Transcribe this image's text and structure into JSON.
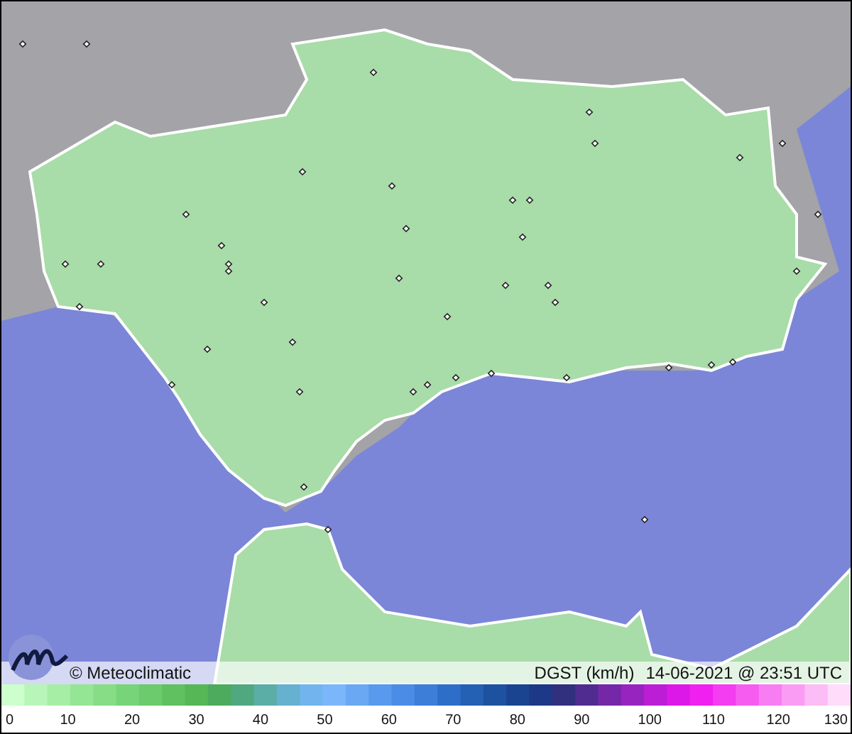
{
  "map": {
    "credit": "© Meteoclimatic",
    "variable": "DGST (km/h)",
    "timestamp": "14-06-2021 @ 23:51 UTC"
  },
  "scale": {
    "ticks": [
      "0",
      "10",
      "20",
      "30",
      "40",
      "50",
      "60",
      "70",
      "80",
      "90",
      "100",
      "110",
      "120",
      "130"
    ]
  }
}
